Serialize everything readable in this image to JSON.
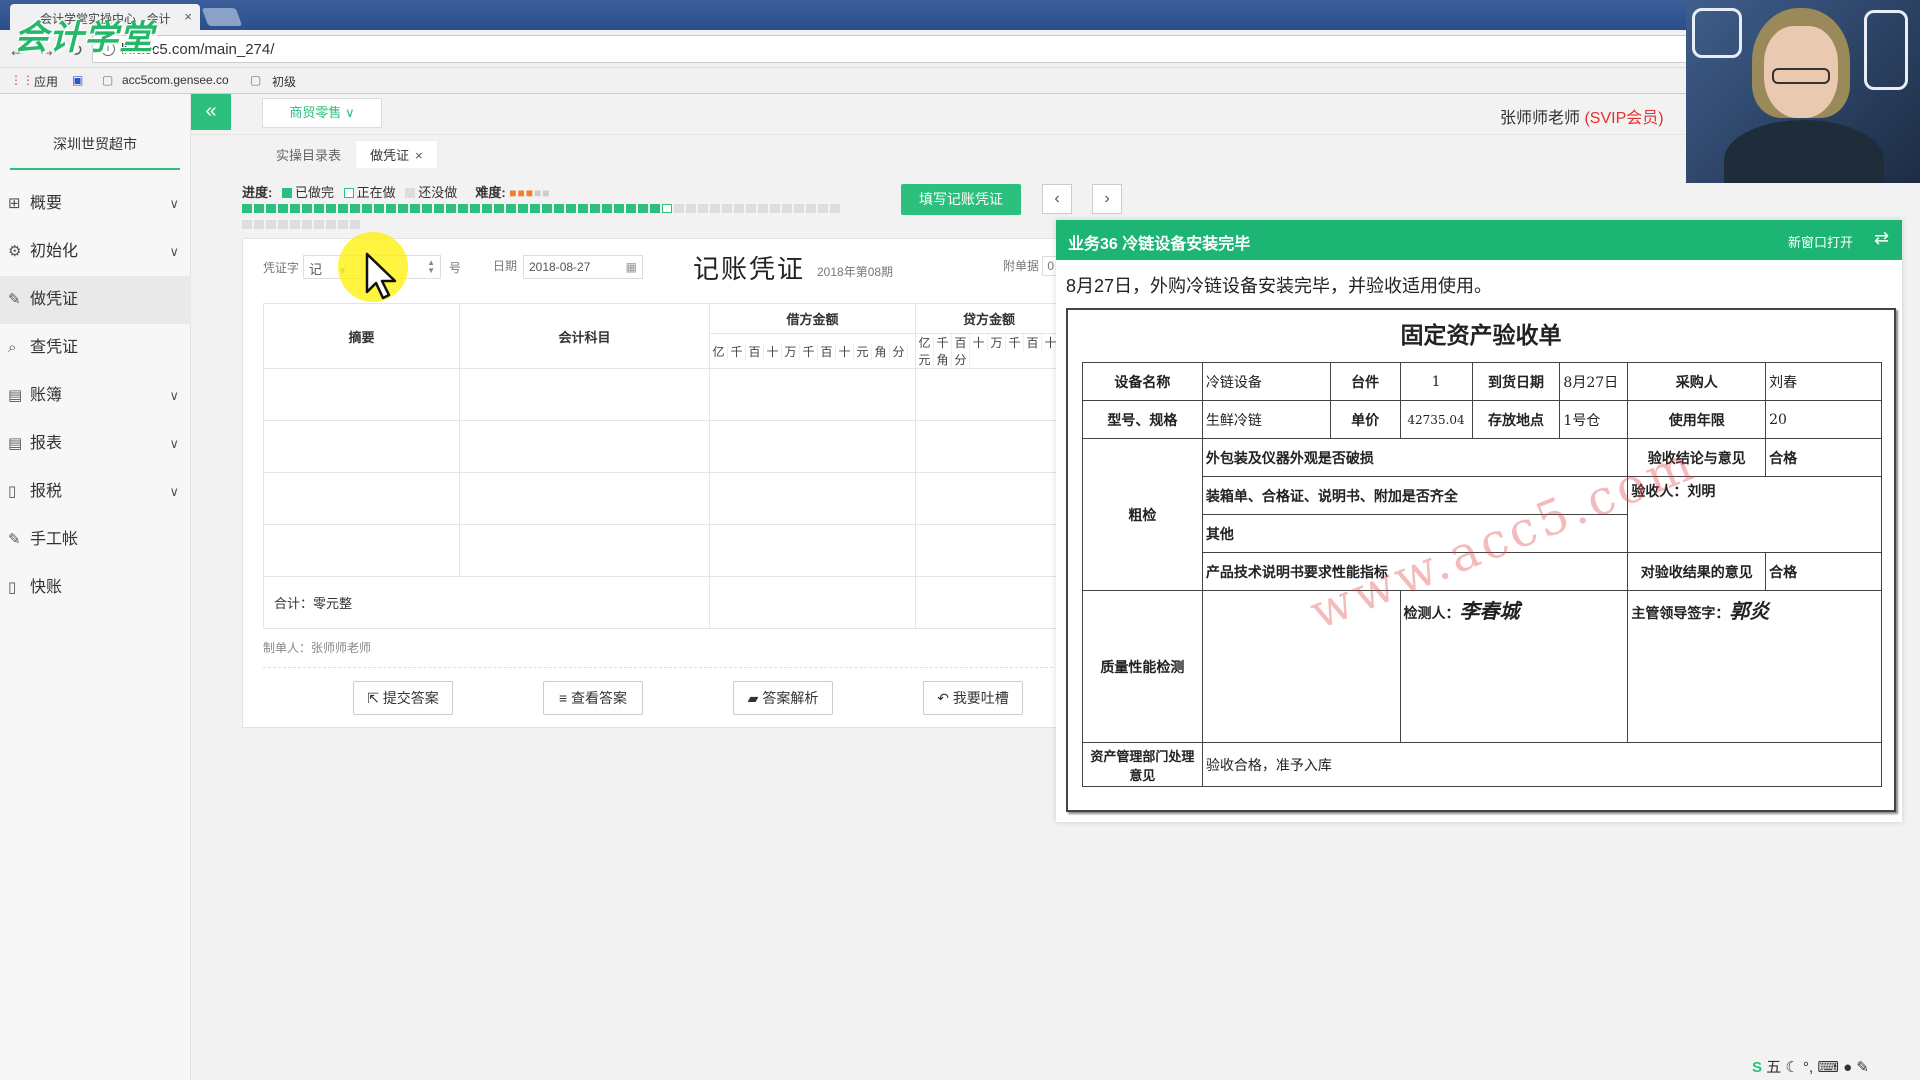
{
  "browser": {
    "tab_title": "会计学堂实操中心 - 会计",
    "url": "lx.acc5.com/main_274/",
    "bookmarks": [
      "应用",
      "acc5com.gensee.co",
      "初级"
    ],
    "logo": "会计学堂"
  },
  "sidebar": {
    "company": "深圳世贸超市",
    "items": [
      {
        "label": "概要",
        "icon": "grid-icon",
        "has_arrow": true
      },
      {
        "label": "初始化",
        "icon": "gear-icon",
        "has_arrow": true
      },
      {
        "label": "做凭证",
        "icon": "pen-icon",
        "has_arrow": false,
        "active": true
      },
      {
        "label": "查凭证",
        "icon": "search-icon",
        "has_arrow": false
      },
      {
        "label": "账簿",
        "icon": "book-icon",
        "has_arrow": true
      },
      {
        "label": "报表",
        "icon": "report-icon",
        "has_arrow": true
      },
      {
        "label": "报税",
        "icon": "file-icon",
        "has_arrow": true
      },
      {
        "label": "手工帐",
        "icon": "pen-icon",
        "has_arrow": false
      },
      {
        "label": "快账",
        "icon": "file-icon",
        "has_arrow": false
      }
    ]
  },
  "header": {
    "industry": "商贸零售",
    "user": "张师师老师",
    "membership": "(SVIP会员)"
  },
  "tabs": [
    {
      "label": "实操目录表",
      "active": false
    },
    {
      "label": "做凭证",
      "active": true
    }
  ],
  "progress": {
    "label": "进度:",
    "done": "已做完",
    "doing": "正在做",
    "todo": "还没做",
    "difficulty_label": "难度:",
    "difficulty": 3,
    "difficulty_max": 5,
    "done_count": 35,
    "current_index": 36,
    "total": 60
  },
  "toolbar": {
    "fill_button": "填写记账凭证",
    "prev": "‹",
    "next": "›"
  },
  "voucher": {
    "word_label": "凭证字",
    "word_value": "记",
    "number_suffix": "号",
    "date_label": "日期",
    "date": "2018-08-27",
    "title": "记账凭证",
    "period": "2018年第08期",
    "attach_label": "附单据",
    "attach_value": "0",
    "col_summary": "摘要",
    "col_account": "会计科目",
    "col_debit": "借方金额",
    "col_credit": "贷方金额",
    "digits": [
      "亿",
      "千",
      "百",
      "十",
      "万",
      "千",
      "百",
      "十",
      "元",
      "角",
      "分"
    ],
    "total_label": "合计：零元整",
    "maker": "制单人：张师师老师",
    "buttons": {
      "submit": "提交答案",
      "view_answer": "查看答案",
      "analysis": "答案解析",
      "feedback": "我要吐槽"
    }
  },
  "business": {
    "title": "业务36 冷链设备安装完毕",
    "open_new": "新窗口打开",
    "description": "8月27日，外购冷链设备安装完毕，并验收适用使用。",
    "doc": {
      "title": "固定资产验收单",
      "equip_name_label": "设备名称",
      "equip_name": "冷链设备",
      "qty_label": "台件",
      "qty": "1",
      "arrival_label": "到货日期",
      "arrival": "8月27日",
      "buyer_label": "采购人",
      "buyer": "刘春",
      "model_label": "型号、规格",
      "model": "生鲜冷链",
      "price_label": "单价",
      "price": "42735.04",
      "location_label": "存放地点",
      "location": "1号仓",
      "years_label": "使用年限",
      "years": "20",
      "rough_label": "粗检",
      "rough_1": "外包装及仪器外观是否破损",
      "rough_2": "装箱单、合格证、说明书、附加是否齐全",
      "rough_3": "其他",
      "rough_4": "产品技术说明书要求性能指标",
      "conclusion_label": "验收结论与意见",
      "conclusion": "合格",
      "inspector": "验收人：刘明",
      "result_opinion_label": "对验收结果的意见",
      "result_opinion": "合格",
      "quality_label": "质量性能检测",
      "tester_label": "检测人：",
      "tester_sig": "李春城",
      "leader_label": "主管领导签字：",
      "leader_sig": "郭炎",
      "dept_label": "资产管理部门处理意见",
      "dept_opinion": "验收合格，准予入库",
      "watermark": "www.acc5.com"
    }
  },
  "tray": {
    "ime": "五"
  }
}
